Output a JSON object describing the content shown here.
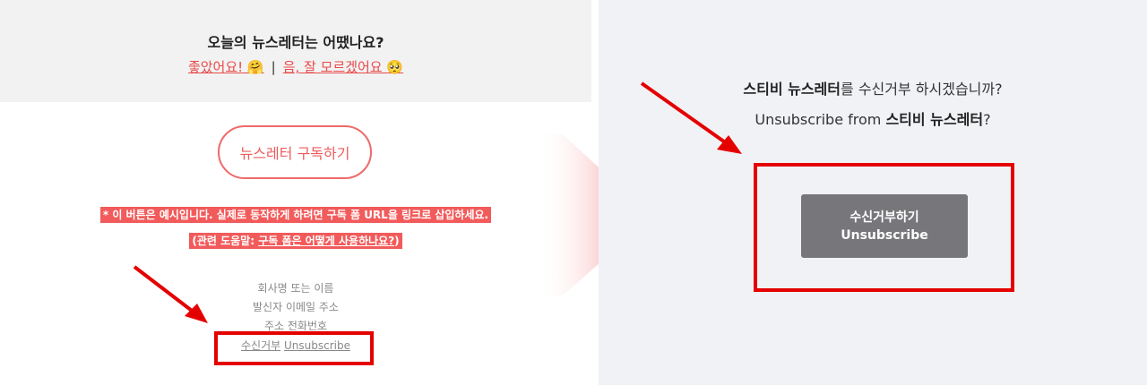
{
  "left": {
    "feedback": {
      "question": "오늘의 뉴스레터는 어땠나요?",
      "good_label": "좋았어요! 🤗",
      "separator": "|",
      "unsure_label": "음, 잘 모르겠어요 🥺"
    },
    "subscribe_button": "뉴스레터 구독하기",
    "notice": {
      "line1": "* 이 버튼은 예시입니다. 실제로 동작하게 하려면 구독 폼 URL을 링크로 삽입하세요.",
      "help_prefix": "(관련 도움말: ",
      "help_link": "구독 폼은 어떻게 사용하나요?",
      "help_suffix": ")"
    },
    "footer": {
      "company": "회사명 또는 이름",
      "sender_email": "발신자 이메일 주소",
      "address_phone": "주소 전화번호",
      "unsubscribe_ko": "수신거부",
      "unsubscribe_en": "Unsubscribe"
    }
  },
  "right": {
    "line1_strong": "스티비 뉴스레터",
    "line1_rest": "를 수신거부 하시겠습니까?",
    "line2_prefix": "Unsubscribe from ",
    "line2_strong": "스티비 뉴스레터",
    "line2_suffix": "?",
    "button_ko": "수신거부하기",
    "button_en": "Unsubscribe"
  },
  "colors": {
    "accent_red": "#e50000",
    "brand_coral": "#ee5c5c",
    "button_gray": "#77777b"
  }
}
